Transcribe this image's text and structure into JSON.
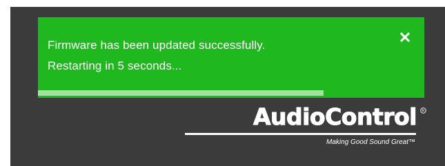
{
  "notification": {
    "line1": "Firmware has been updated successfully.",
    "line2": "Restarting in 5 seconds...",
    "close_icon": "close-icon",
    "progress": 0.74,
    "colors": {
      "background": "#1fb81f",
      "progress_fill": "#9fe39f",
      "text": "#ffffff"
    }
  },
  "brand": {
    "name": "AudioControl",
    "registered_mark": "registered-icon",
    "tagline": "Making Good Sound Great™"
  },
  "colors": {
    "page_background": "#3b3b3b"
  }
}
